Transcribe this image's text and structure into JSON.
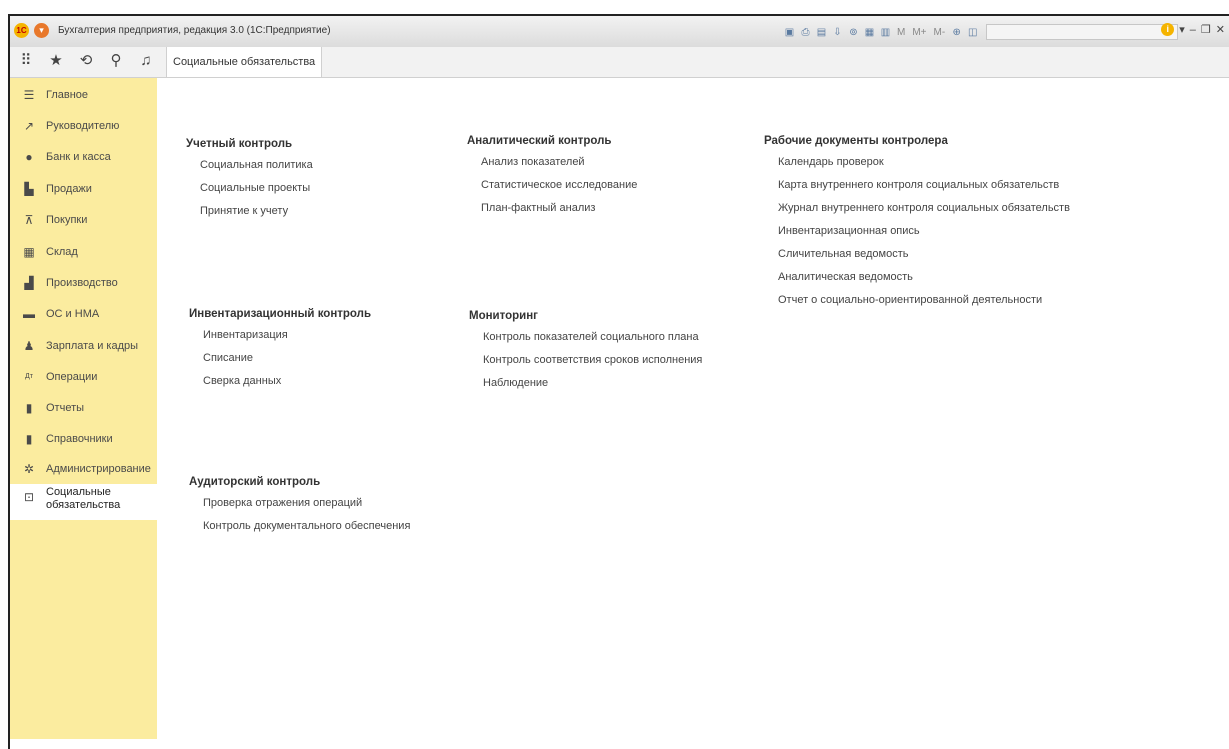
{
  "app": {
    "title": "Бухгалтерия предприятия, редакция 3.0 (1С:Предприятие)",
    "logo_text": "1С",
    "mem_buttons": [
      "M",
      "M+",
      "M-"
    ]
  },
  "tab": {
    "label": "Социальные обязательства"
  },
  "sidebar": {
    "items": [
      {
        "label": "Главное",
        "icon": "menu-lines-icon"
      },
      {
        "label": "Руководителю",
        "icon": "trend-icon"
      },
      {
        "label": "Банк и касса",
        "icon": "coin-icon"
      },
      {
        "label": "Продажи",
        "icon": "bag-icon"
      },
      {
        "label": "Покупки",
        "icon": "cart-icon"
      },
      {
        "label": "Склад",
        "icon": "warehouse-icon"
      },
      {
        "label": "Производство",
        "icon": "factory-icon"
      },
      {
        "label": "ОС и НМА",
        "icon": "truck-icon"
      },
      {
        "label": "Зарплата и кадры",
        "icon": "person-icon"
      },
      {
        "label": "Операции",
        "icon": "dt-kt-icon"
      },
      {
        "label": "Отчеты",
        "icon": "bar-chart-icon"
      },
      {
        "label": "Справочники",
        "icon": "book-icon"
      },
      {
        "label": "Администрирование",
        "icon": "gear-icon"
      },
      {
        "label": "Социальные обязательства",
        "icon": "social-icon"
      }
    ]
  },
  "groups": {
    "uchet": {
      "title": "Учетный контроль",
      "links": [
        "Социальная политика",
        "Социальные проекты",
        "Принятие к учету"
      ]
    },
    "analytic": {
      "title": "Аналитический контроль",
      "links": [
        "Анализ показателей",
        "Статистическое исследование",
        "План-фактный анализ"
      ]
    },
    "workdocs": {
      "title": "Рабочие документы контролера",
      "links": [
        "Календарь проверок",
        "Карта внутреннего контроля социальных обязательств",
        "Журнал внутреннего контроля социальных обязательств",
        "Инвентаризационная опись",
        "Сличительная ведомость",
        "Аналитическая ведомость",
        "Отчет о социально-ориентированной деятельности"
      ]
    },
    "inventory": {
      "title": "Инвентаризационный контроль",
      "links": [
        "Инвентаризация",
        "Списание",
        "Сверка данных"
      ]
    },
    "monitoring": {
      "title": "Мониторинг",
      "links": [
        "Контроль показателей социального плана",
        "Контроль соответствия сроков исполнения",
        "Наблюдение"
      ]
    },
    "audit": {
      "title": "Аудиторский контроль",
      "links": [
        "Проверка отражения операций",
        "Контроль документального обеспечения"
      ]
    }
  }
}
